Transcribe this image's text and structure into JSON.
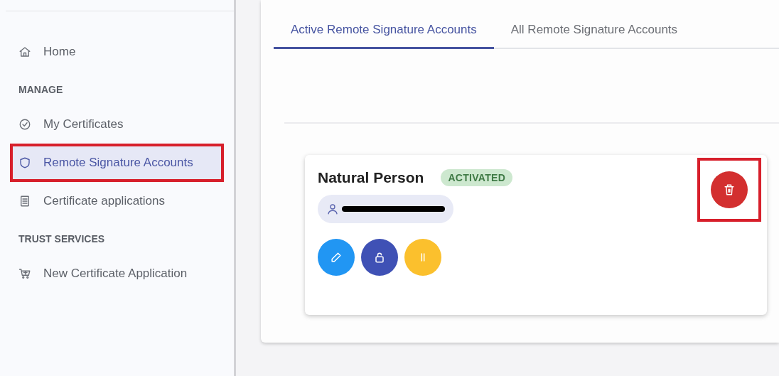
{
  "sidebar": {
    "items": [
      {
        "kind": "link",
        "label": "Home",
        "selected": false,
        "highlighted": false
      },
      {
        "kind": "heading",
        "label": "MANAGE"
      },
      {
        "kind": "link",
        "label": "My Certificates",
        "selected": false,
        "highlighted": false
      },
      {
        "kind": "link",
        "label": "Remote Signature Accounts",
        "selected": true,
        "highlighted": true
      },
      {
        "kind": "link",
        "label": "Certificate applications",
        "selected": false,
        "highlighted": false
      },
      {
        "kind": "heading",
        "label": "TRUST SERVICES"
      },
      {
        "kind": "link",
        "label": "New Certificate Application",
        "selected": false,
        "highlighted": false
      }
    ]
  },
  "tabs": [
    {
      "label": "Active Remote Signature Accounts",
      "selected": true
    },
    {
      "label": "All Remote Signature Accounts",
      "selected": false
    }
  ],
  "card": {
    "title": "Natural Person",
    "status": "ACTIVATED",
    "user_chip": {
      "redacted": true
    },
    "delete_button": {
      "highlighted": true
    },
    "actions": [
      {
        "color": "#2196f3"
      },
      {
        "color": "#3f51b5"
      },
      {
        "color": "#fbc02d"
      }
    ]
  }
}
